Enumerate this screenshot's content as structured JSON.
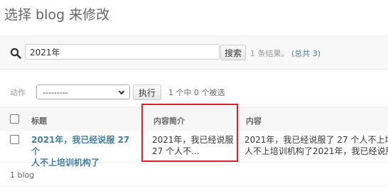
{
  "page_title": "选择 blog 来修改",
  "search": {
    "value": "2021年",
    "button_label": "搜索",
    "result_text": "1 条结果。",
    "total_link": "(总共 3)"
  },
  "actions": {
    "label": "动作",
    "select_value": "---------",
    "run_label": "执行",
    "selection_counter": "1 个中 0 个被选"
  },
  "table": {
    "columns": [
      "标题",
      "内容简介",
      "内容"
    ],
    "rows": [
      {
        "title_line1": "2021年，我已经说服 27 个",
        "title_line2": "人不上培训机构了",
        "summary_line1": "2021年，我已经说服",
        "summary_line2": "27 个人不...",
        "content_line1": "2021年，我已经说服了 27 个人不上培训",
        "content_line2": "人不上培训机构了2021年，我已经说服"
      }
    ]
  },
  "footer": {
    "count": "1 blog"
  },
  "colors": {
    "link": "#447e9b",
    "highlight": "#d9232d"
  }
}
